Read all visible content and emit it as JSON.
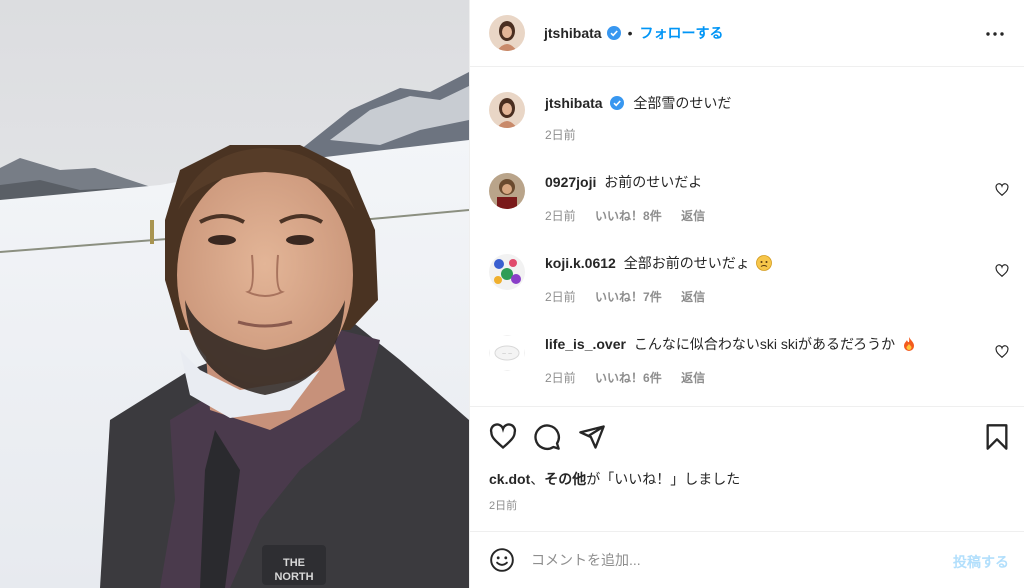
{
  "post": {
    "author": "jtshibata",
    "follow_label": "フォローする",
    "separator": "•",
    "caption": "全部雪のせいだ",
    "caption_time": "2日前"
  },
  "comments": [
    {
      "user": "0927joji",
      "text": "お前のせいだよ",
      "time": "2日前",
      "likes": "いいね！8件",
      "reply": "返信"
    },
    {
      "user": "koji.k.0612",
      "text": "全部お前のせいだょ",
      "emoji": "worried-face-emoji",
      "time": "2日前",
      "likes": "いいね！7件",
      "reply": "返信"
    },
    {
      "user": "life_is_.over",
      "text": "こんなに似合わないski skiがあるだろうか",
      "emoji": "fire-emoji",
      "time": "2日前",
      "likes": "いいね！6件",
      "reply": "返信"
    }
  ],
  "likes_summary": {
    "users": "ck.dot",
    "sep": "、",
    "others": "その他",
    "suffix": "が「いいね！」しました"
  },
  "post_date": "2日前",
  "composer": {
    "placeholder": "コメントを追加...",
    "post_label": "投稿する"
  },
  "icons": [
    "verified-badge-icon",
    "more-options-icon",
    "heart-icon",
    "comment-icon",
    "share-icon",
    "bookmark-icon",
    "emoji-smiley-icon"
  ],
  "colors": {
    "accent": "#0095f6",
    "post_disabled": "#b2dffc",
    "muted": "#8e8e8e",
    "verified": "#3897f0"
  }
}
